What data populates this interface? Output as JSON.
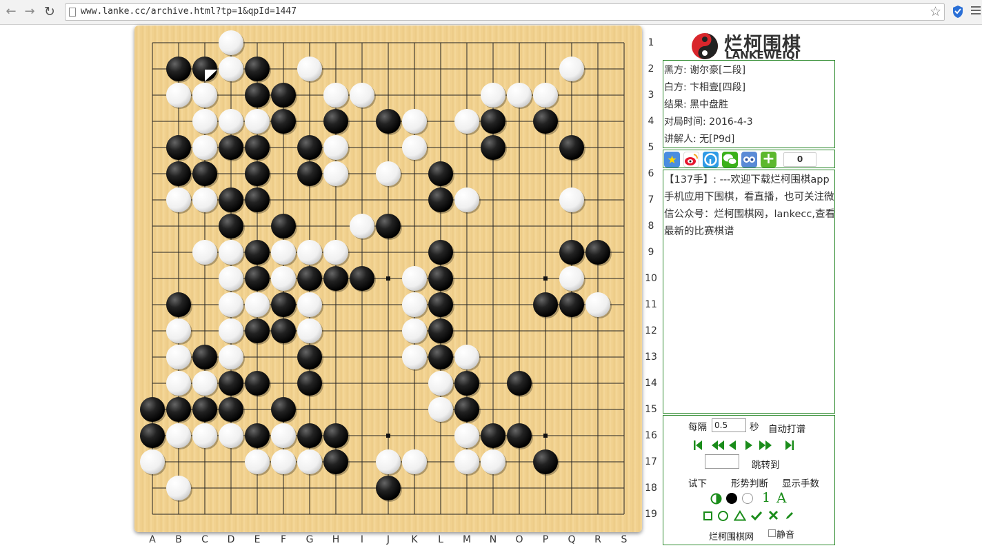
{
  "browser": {
    "url": "www.lanke.cc/archive.html?tp=1&qpId=1447"
  },
  "board": {
    "columns": [
      "A",
      "B",
      "C",
      "D",
      "E",
      "F",
      "G",
      "H",
      "I",
      "J",
      "K",
      "L",
      "M",
      "N",
      "O",
      "P",
      "Q",
      "R",
      "S"
    ],
    "rows": [
      "1",
      "2",
      "3",
      "4",
      "5",
      "6",
      "7",
      "8",
      "9",
      "10",
      "11",
      "12",
      "13",
      "14",
      "15",
      "16",
      "17",
      "18",
      "19"
    ],
    "last_move": "C2",
    "black": [
      "B2",
      "C2",
      "E2",
      "E3",
      "F3",
      "F4",
      "H4",
      "J4",
      "N4",
      "P4",
      "D5",
      "E5",
      "G5",
      "N5",
      "Q5",
      "B5",
      "B6",
      "C6",
      "E6",
      "G6",
      "L6",
      "D7",
      "E7",
      "L7",
      "D8",
      "F8",
      "J8",
      "E9",
      "L9",
      "Q9",
      "R9",
      "E10",
      "G10",
      "H10",
      "I10",
      "L10",
      "B11",
      "F11",
      "L11",
      "P11",
      "Q11",
      "E12",
      "F12",
      "L12",
      "C13",
      "G13",
      "L13",
      "D14",
      "E14",
      "G14",
      "M14",
      "O14",
      "A15",
      "B15",
      "C15",
      "D15",
      "F15",
      "M15",
      "A16",
      "E16",
      "G16",
      "H16",
      "N16",
      "O16",
      "H17",
      "P17",
      "J18"
    ],
    "white": [
      "D1",
      "D2",
      "G2",
      "Q2",
      "B3",
      "C3",
      "H3",
      "I3",
      "N3",
      "O3",
      "P3",
      "C4",
      "D4",
      "E4",
      "K4",
      "M4",
      "C5",
      "H5",
      "K5",
      "H6",
      "J6",
      "B7",
      "C7",
      "M7",
      "Q7",
      "I8",
      "C9",
      "D9",
      "F9",
      "G9",
      "H9",
      "D10",
      "F10",
      "K10",
      "Q10",
      "D11",
      "E11",
      "G11",
      "K11",
      "R11",
      "B12",
      "D12",
      "G12",
      "K12",
      "B13",
      "D13",
      "K13",
      "M13",
      "B14",
      "C14",
      "L14",
      "L15",
      "B16",
      "C16",
      "D16",
      "F16",
      "M16",
      "A17",
      "E17",
      "F17",
      "G17",
      "J17",
      "K17",
      "M17",
      "N17",
      "B18"
    ]
  },
  "logo": {
    "cn": "烂柯围棋",
    "en": "LANKEWEIQI"
  },
  "info": {
    "black": "黑方: 谢尔豪[二段]",
    "white": "白方: 卞相壹[四段]",
    "result": "结果: 黑中盘胜",
    "date": "对局时间: 2016-4-3",
    "commentator": "讲解人: 无[P9d]"
  },
  "share": {
    "count": "0"
  },
  "comment": {
    "text": "【137手】: ---欢迎下载烂柯围棋app手机应用下围棋，看直播，也可关注微信公众号：烂柯围棋网，lankecc,查看最新的比赛棋谱"
  },
  "controls": {
    "interval_label": "每隔",
    "interval_value": "0.5",
    "seconds_label": "秒",
    "auto_play": "自动打谱",
    "jump_label": "跳转到",
    "try_move": "试下",
    "judge": "形势判断",
    "show_numbers": "显示手数",
    "number_tool": "1",
    "letter_tool": "A",
    "site_name": "烂柯围棋网",
    "mute": "静音"
  },
  "colors": {
    "accent_green": "#2d8a2d",
    "nav_green": "#1a8c1a",
    "board_wood": "#f2d290"
  }
}
